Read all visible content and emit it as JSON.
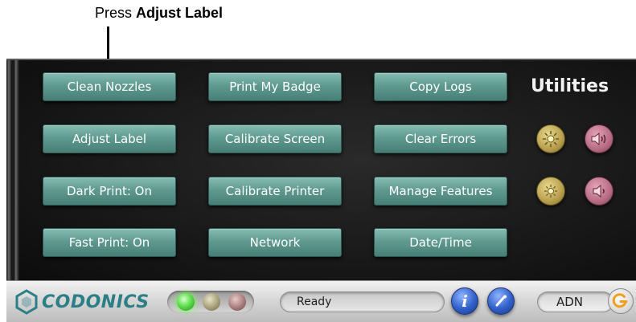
{
  "callout": {
    "prefix": "Press ",
    "target": "Adjust Label"
  },
  "screen": {
    "title": "Utilities",
    "buttons": {
      "clean_nozzles": "Clean Nozzles",
      "print_my_badge": "Print My Badge",
      "copy_logs": "Copy Logs",
      "adjust_label": "Adjust Label",
      "calibrate_screen": "Calibrate Screen",
      "clear_errors": "Clear Errors",
      "dark_print": "Dark Print: On",
      "calibrate_printer": "Calibrate Printer",
      "manage_features": "Manage Features",
      "fast_print": "Fast Print: On",
      "network": "Network",
      "date_time": "Date/Time"
    },
    "controls": [
      "brightness-up-icon",
      "volume-up-icon",
      "brightness-down-icon",
      "volume-down-icon"
    ]
  },
  "statusbar": {
    "brand": "CODONICS",
    "status_text": "Ready",
    "user": "ADN",
    "indicators": [
      "green",
      "amber",
      "red"
    ]
  },
  "colors": {
    "button": "#5f9a90",
    "brand": "#2c7f86",
    "led_on": "#5fe04d"
  }
}
